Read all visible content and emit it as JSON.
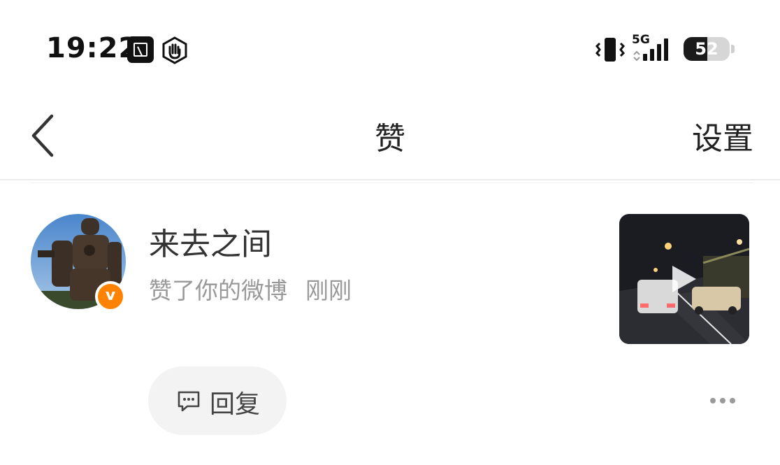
{
  "status_bar": {
    "time": "19:22",
    "network": "5G",
    "battery": "52",
    "battery_level": 0.52
  },
  "nav": {
    "back_icon": "chevron-left-icon",
    "title": "赞",
    "settings": "设置"
  },
  "notification": {
    "username": "来去之间",
    "verified": true,
    "action": "赞了你的微博",
    "time_ago": "刚刚",
    "reply_label": "回复",
    "more_icon": "more-dots-icon"
  },
  "colors": {
    "badge": "#ff8200",
    "secondary_text": "#999999"
  }
}
